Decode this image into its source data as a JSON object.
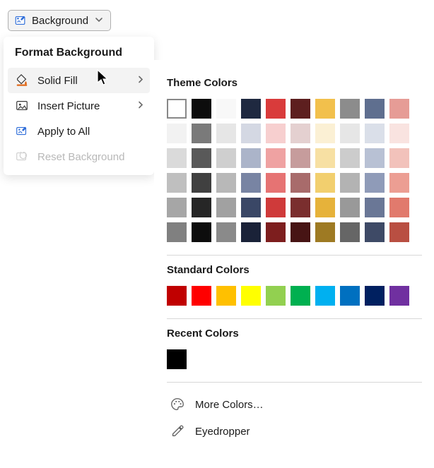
{
  "ribbon": {
    "label": "Background"
  },
  "menu": {
    "title": "Format Background",
    "items": [
      {
        "label": "Solid Fill",
        "has_sub": true,
        "hover": true,
        "icon": "bucket-orange",
        "enabled": true
      },
      {
        "label": "Insert Picture",
        "has_sub": true,
        "hover": false,
        "icon": "picture",
        "enabled": true
      },
      {
        "label": "Apply to All",
        "has_sub": false,
        "hover": false,
        "icon": "bucket-blue",
        "enabled": true
      },
      {
        "label": "Reset Background",
        "has_sub": false,
        "hover": false,
        "icon": "reset",
        "enabled": false
      }
    ]
  },
  "color_picker": {
    "theme_title": "Theme Colors",
    "theme_rows": [
      [
        "#ffffff",
        "#0d0d0d",
        "#f8f8f8",
        "#1f2940",
        "#d93b3b",
        "#5d1f1f",
        "#f2c04c",
        "#8c8c8c",
        "#5f6f8f",
        "#e69c96"
      ],
      [
        "#f2f2f2",
        "#7a7a7a",
        "#e6e6e6",
        "#d4d8e3",
        "#f7cfcf",
        "#e4d0d0",
        "#fbf0d4",
        "#e6e6e6",
        "#dadfe9",
        "#f9e3e0"
      ],
      [
        "#dadada",
        "#595959",
        "#cfcfcf",
        "#abb4c9",
        "#efa2a2",
        "#c69c9c",
        "#f7e0a3",
        "#cccccc",
        "#b8c1d4",
        "#f2c2bb"
      ],
      [
        "#bfbfbf",
        "#404040",
        "#b8b8b8",
        "#7884a3",
        "#e67373",
        "#a86b6b",
        "#f2cf6e",
        "#b3b3b3",
        "#8f9bb8",
        "#ec9e93"
      ],
      [
        "#a6a6a6",
        "#262626",
        "#a1a1a1",
        "#3a4766",
        "#cf3a3a",
        "#7a2e2e",
        "#e6b23a",
        "#999999",
        "#6a7796",
        "#e17a6d"
      ],
      [
        "#808080",
        "#0d0d0d",
        "#8a8a8a",
        "#1a2238",
        "#7d1e1e",
        "#471414",
        "#9e7a23",
        "#666666",
        "#3e4a66",
        "#b94f42"
      ]
    ],
    "selected_index": 0,
    "standard_title": "Standard Colors",
    "standard": [
      "#c00000",
      "#ff0000",
      "#ffc000",
      "#ffff00",
      "#92d050",
      "#00b050",
      "#00b0f0",
      "#0070c0",
      "#002060",
      "#7030a0"
    ],
    "recent_title": "Recent Colors",
    "recent": [
      "#000000"
    ],
    "more_colors": "More Colors…",
    "eyedropper": "Eyedropper"
  }
}
